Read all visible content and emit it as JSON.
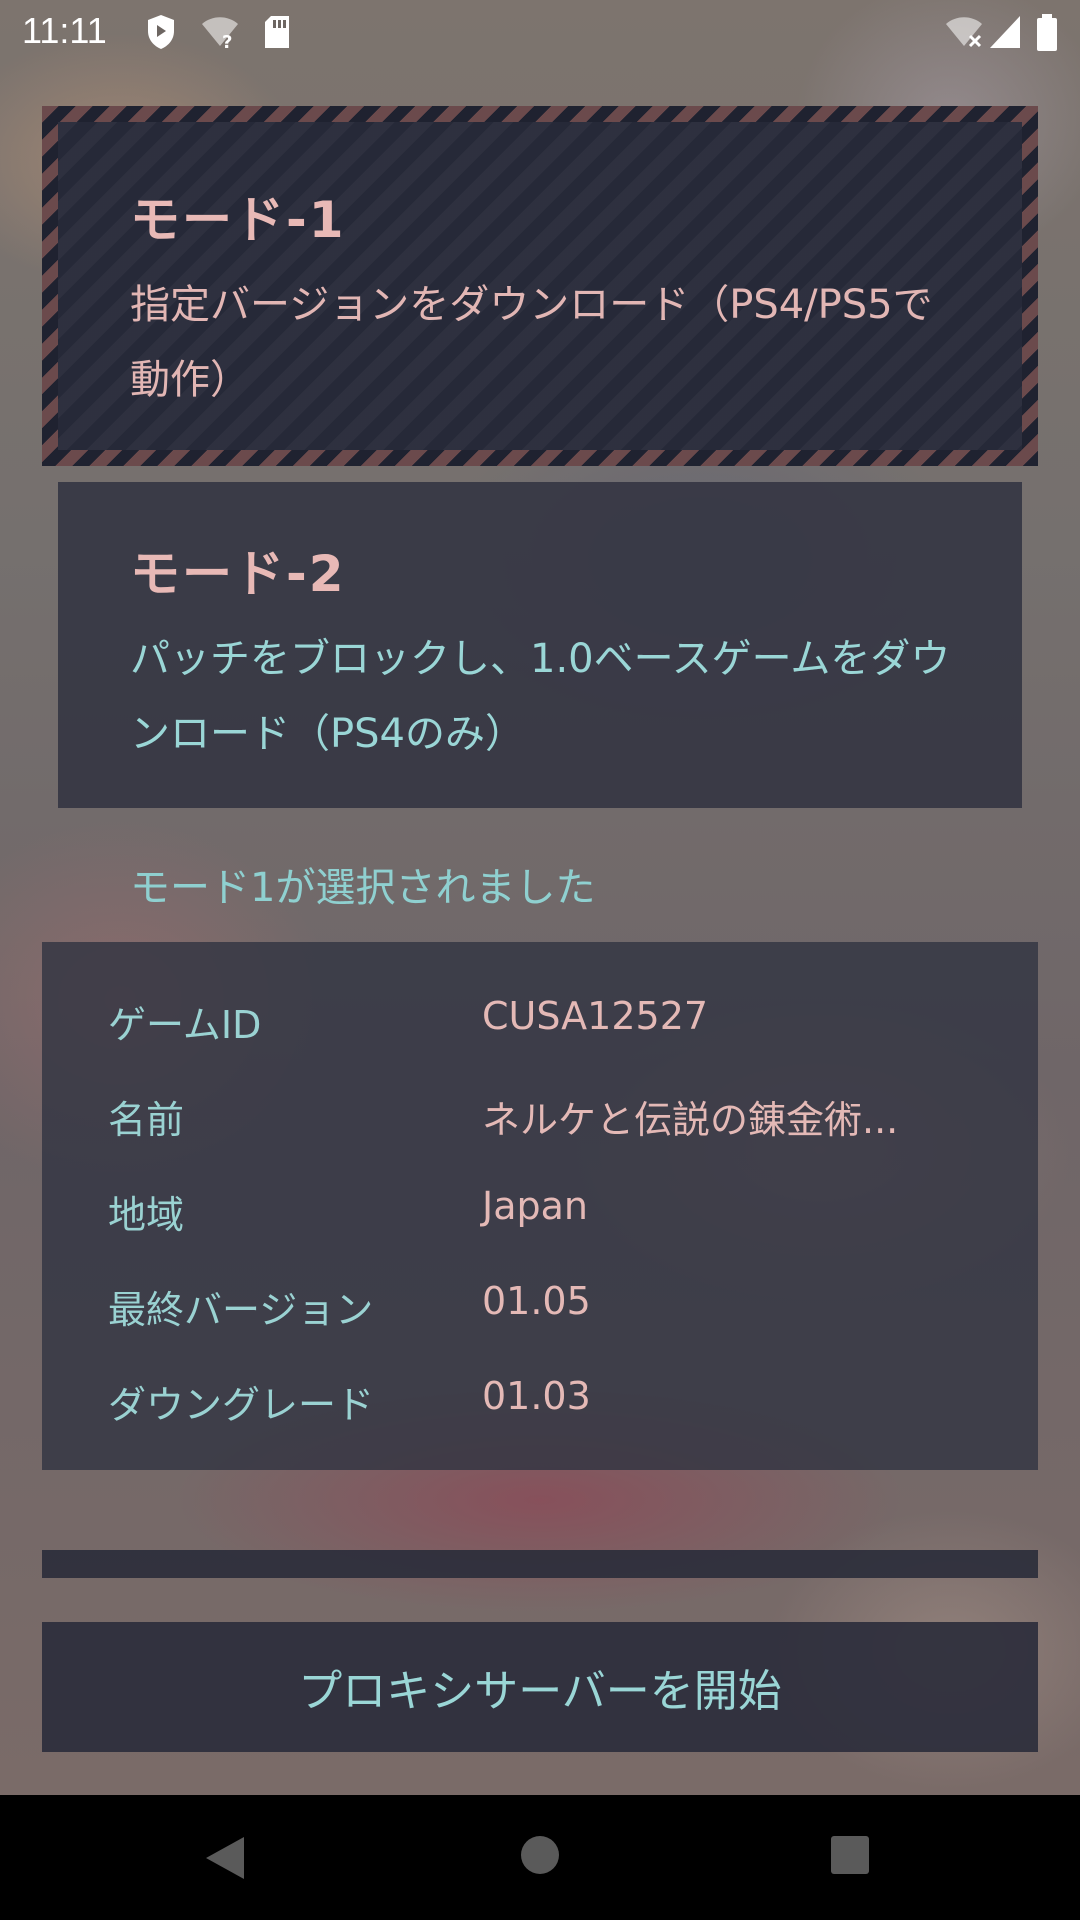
{
  "status_bar": {
    "time": "11:11"
  },
  "mode1": {
    "title": "モード-1",
    "description": "指定バージョンをダウンロード（PS4/PS5で動作）"
  },
  "mode2": {
    "title": "モード-2",
    "description": "パッチをブロックし、1.0ベースゲームをダウンロード（PS4のみ）"
  },
  "selected_message": "モード1が選択されました",
  "game_info": {
    "rows": [
      {
        "label": "ゲームID",
        "value": "CUSA12527"
      },
      {
        "label": "名前",
        "value": "ネルケと伝説の錬金術..."
      },
      {
        "label": "地域",
        "value": "Japan"
      },
      {
        "label": "最終バージョン",
        "value": "01.05"
      },
      {
        "label": "ダウングレード",
        "value": "01.03"
      }
    ]
  },
  "start_button": "プロキシサーバーを開始",
  "colors": {
    "accent_cyan": "#9ad2d2",
    "accent_pink": "#e4b9b6",
    "card_bg": "#2a2c3a"
  }
}
